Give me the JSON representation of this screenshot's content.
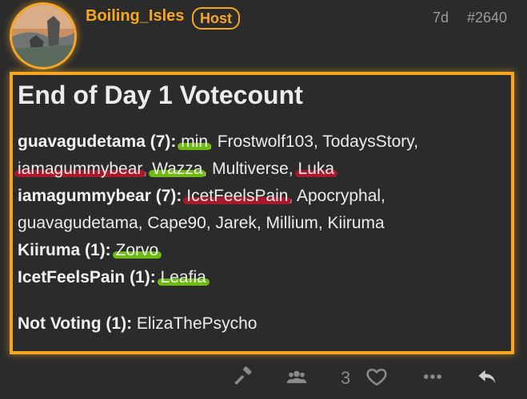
{
  "post": {
    "username": "Boiling_Isles",
    "role_badge": "Host",
    "time": "7d",
    "number": "#2640",
    "title": "End of Day 1 Votecount",
    "votes": [
      {
        "candidate": "guavagudetama (7):",
        "voters_line1": [
          {
            "name": "min",
            "highlight": "green"
          },
          {
            "name": ", Frostwolf103, TodaysStory,",
            "highlight": null
          }
        ],
        "voters_line2": [
          {
            "name": "iamagummybear",
            "highlight": "red"
          },
          {
            "name": ", ",
            "highlight": null
          },
          {
            "name": "Wazza",
            "highlight": "green"
          },
          {
            "name": ", Multiverse, ",
            "highlight": null
          },
          {
            "name": "Luka",
            "highlight": "red"
          }
        ]
      },
      {
        "candidate": "iamagummybear (7):",
        "voters_line1": [
          {
            "name": "IcetFeelsPain",
            "highlight": "red"
          },
          {
            "name": ", Apocryphal,",
            "highlight": null
          }
        ],
        "voters_line2": [
          {
            "name": "guavagudetama, Cape90, Jarek, Millium, Kiiruma",
            "highlight": null
          }
        ]
      },
      {
        "candidate": "Kiiruma (1):",
        "voters_line1": [
          {
            "name": "Zorvo",
            "highlight": "green"
          }
        ]
      },
      {
        "candidate": "IcetFeelsPain (1):",
        "voters_line1": [
          {
            "name": "Leafia",
            "highlight": "green"
          }
        ]
      }
    ],
    "not_voting_label": "Not Voting (1):",
    "not_voting_names": "ElizaThePsycho"
  },
  "actions": {
    "like_count": "3",
    "icons": [
      "gavel-icon",
      "users-icon",
      "heart-icon",
      "more-icon",
      "reply-icon"
    ]
  },
  "colors": {
    "accent": "#f6a623",
    "highlight_green": "#76c613",
    "highlight_red": "#b3192b",
    "background": "#2b2b2b"
  }
}
